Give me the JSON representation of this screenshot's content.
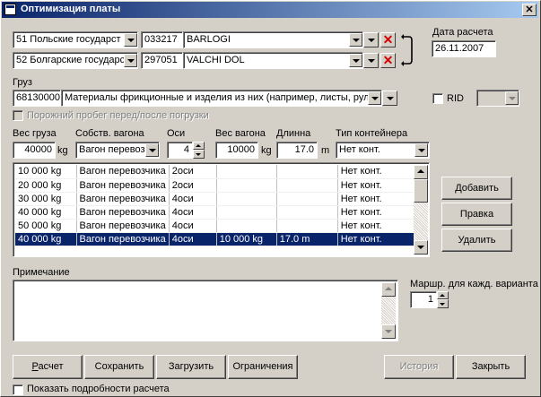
{
  "title": "Оптимизация платы",
  "close_glyph": "✕",
  "route": {
    "from": {
      "country": "51 Польские государст",
      "code": "033217",
      "station": "BARLOGI"
    },
    "to": {
      "country": "52 Болгарские государс",
      "code": "297051",
      "station": "VALCHI DOL"
    },
    "remove_glyph": "✕"
  },
  "date": {
    "label": "Дата расчета",
    "value": "26.11.2007"
  },
  "cargo": {
    "label": "Груз",
    "code": "68130000",
    "name": "Материалы фрикционные и изделия из них (например, листы, рул",
    "rid_label": "RID",
    "empty_run_label": "Порожний пробег перед/после  погрузки"
  },
  "params": {
    "weight_label": "Вес груза",
    "weight_value": "40000",
    "weight_unit": "kg",
    "owner_label": "Собств. вагона",
    "owner_value": "Вагон перевоз",
    "axles_label": "Оси",
    "axles_value": "4",
    "wagon_weight_label": "Вес вагона",
    "wagon_weight_value": "10000",
    "wagon_weight_unit": "kg",
    "length_label": "Длинна",
    "length_value": "17.0",
    "length_unit": "m",
    "container_label": "Тип контейнера",
    "container_value": "Нет конт."
  },
  "grid": {
    "rows": [
      {
        "weight": "10 000 kg",
        "owner": "Вагон перевозчика",
        "axles": "2оси",
        "wagon_weight": "",
        "length": "",
        "container": "Нет конт."
      },
      {
        "weight": "20 000 kg",
        "owner": "Вагон перевозчика",
        "axles": "2оси",
        "wagon_weight": "",
        "length": "",
        "container": "Нет конт."
      },
      {
        "weight": "30 000 kg",
        "owner": "Вагон перевозчика",
        "axles": "4оси",
        "wagon_weight": "",
        "length": "",
        "container": "Нет конт."
      },
      {
        "weight": "40 000 kg",
        "owner": "Вагон перевозчика",
        "axles": "4оси",
        "wagon_weight": "",
        "length": "",
        "container": "Нет конт."
      },
      {
        "weight": "50 000 kg",
        "owner": "Вагон перевозчика",
        "axles": "4оси",
        "wagon_weight": "",
        "length": "",
        "container": "Нет конт."
      },
      {
        "weight": "40 000 kg",
        "owner": "Вагон перевозчика",
        "axles": "4оси",
        "wagon_weight": "10 000 kg",
        "length": "17.0 m",
        "container": "Нет конт."
      }
    ],
    "selected_row": 5
  },
  "side_buttons": {
    "add": "Добавить",
    "edit": "Правка",
    "delete": "Удалить"
  },
  "note": {
    "label": "Примечание",
    "value": ""
  },
  "routes": {
    "label": "Маршр. для кажд. варианта",
    "value": "1"
  },
  "bottom_buttons": {
    "calc": "Расчет",
    "save": "Сохранить",
    "load": "Загрузить",
    "limits": "Ограничения",
    "history": "История",
    "close": "Закрыть"
  },
  "details_label": "Показать подробности расчета"
}
